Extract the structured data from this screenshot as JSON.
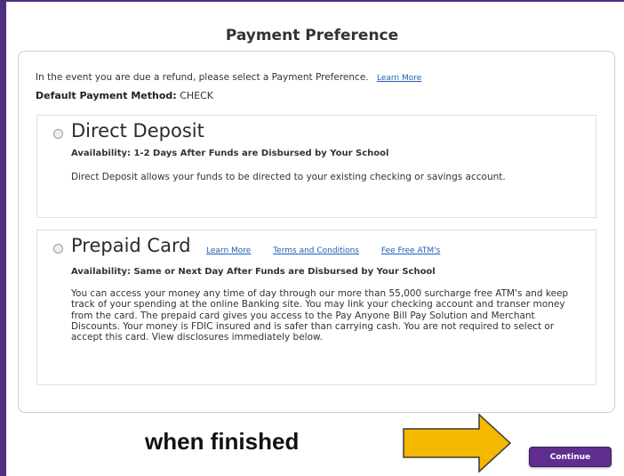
{
  "page": {
    "title": "Payment Preference"
  },
  "intro": {
    "text": "In the event you are due a refund, please select a Payment Preference.",
    "learn_more": "Learn More"
  },
  "default_method": {
    "label": "Default Payment Method:",
    "value": "CHECK"
  },
  "options": [
    {
      "title": "Direct Deposit",
      "availability": "Availability:  1-2 Days After Funds are Disbursed by Your School",
      "description": "Direct Deposit allows your funds to be directed to your existing checking or savings account."
    },
    {
      "title": "Prepaid Card",
      "links": [
        "Learn More",
        "Terms and Conditions",
        "Fee Free ATM's"
      ],
      "availability": "Availability:  Same or Next Day After Funds are Disbursed by Your School",
      "description": "You can access your money any time of day through our more than 55,000 surcharge free ATM's and keep track of your spending at the online Banking site. You may link your checking account and transer money from the card. The prepaid card gives you access to the Pay Anyone Bill Pay Solution and Merchant Discounts. Your money is FDIC insured and is safer than carrying cash. You are not required to select or accept this card. View disclosures immediately below."
    }
  ],
  "annotation": {
    "text": "when finished"
  },
  "continue_button": {
    "label": "Continue"
  },
  "colors": {
    "frame": "#4f2d7f",
    "button": "#5f2e8e",
    "arrow_fill": "#f5b800",
    "link": "#1f5fb5"
  }
}
